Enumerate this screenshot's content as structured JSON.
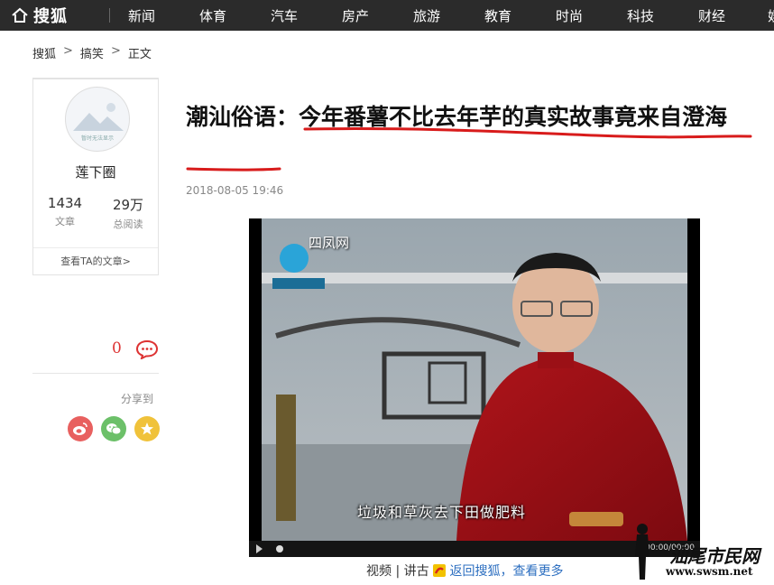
{
  "topnav": {
    "logo_text": "搜狐",
    "items": [
      "新闻",
      "体育",
      "汽车",
      "房产",
      "旅游",
      "教育",
      "时尚",
      "科技",
      "财经",
      "娱"
    ]
  },
  "breadcrumb": {
    "items": [
      "搜狐",
      "搞笑",
      "正文"
    ],
    "separator": ">"
  },
  "author": {
    "avatar_caption": "暂时无法显示",
    "name": "莲下圈",
    "articles_count": "1434",
    "articles_label": "文章",
    "reads_count": "29万",
    "reads_label": "总阅读",
    "view_articles_link": "查看TA的文章>"
  },
  "social": {
    "comment_count": "0",
    "share_label": "分享到",
    "share_icons": [
      "weibo-icon",
      "wechat-icon",
      "qzone-icon"
    ],
    "share_colors": [
      "#e8605f",
      "#6cc069",
      "#f0c23a"
    ]
  },
  "article": {
    "title": "潮汕俗语：今年番薯不比去年芋的真实故事竟来自澄海",
    "pubdate": "2018-08-05 19:46",
    "underline_color": "#d81b1b"
  },
  "video": {
    "station_name": "四凤网",
    "subtitle": "垃圾和草灰去下田做肥料",
    "time": "00:00/00:00",
    "caption_type": "视频",
    "caption_sep": "|",
    "caption_source": "讲古",
    "caption_back": "返回搜狐，",
    "caption_more": "查看更多"
  },
  "watermark": {
    "text": "汕尾市民网",
    "url": "www.swsm.net"
  }
}
